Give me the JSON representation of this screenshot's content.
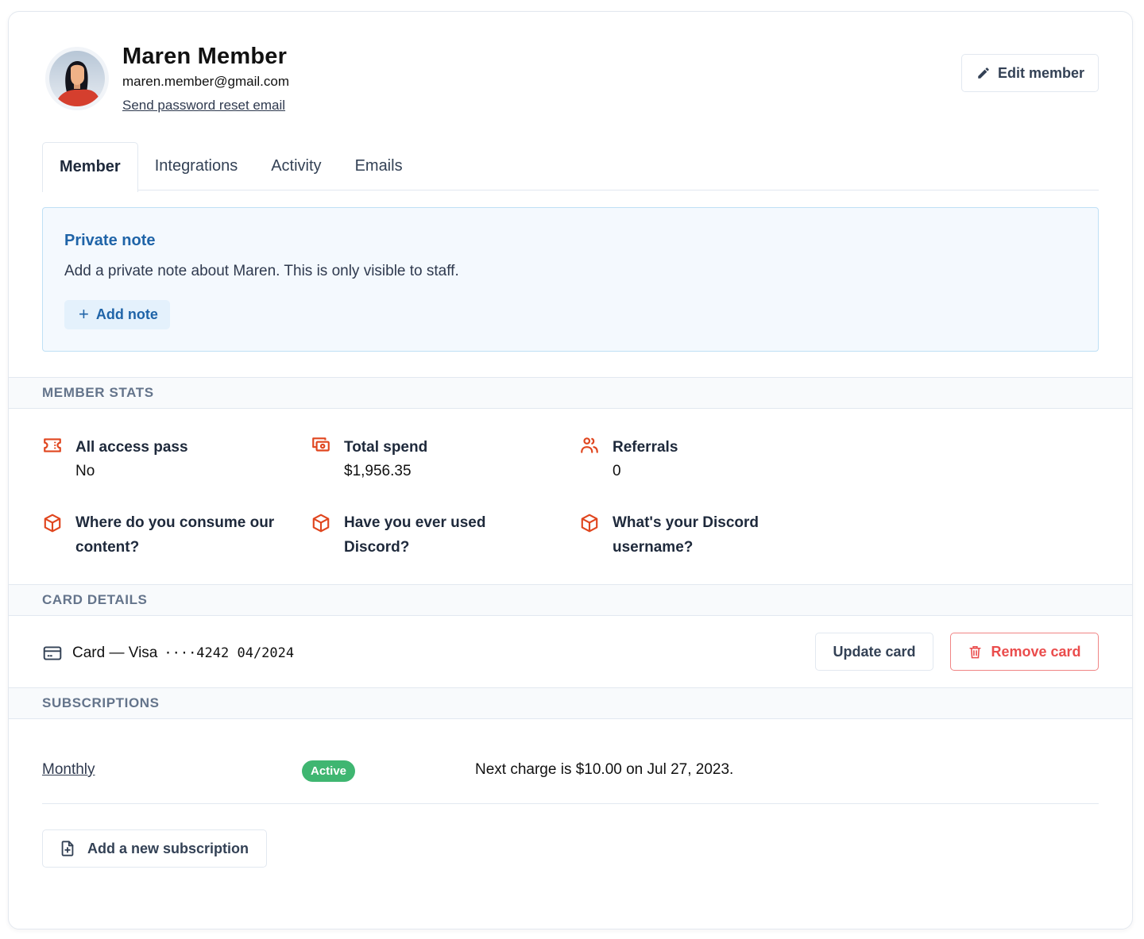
{
  "member": {
    "name": "Maren Member",
    "email": "maren.member@gmail.com",
    "reset_link": "Send password reset email",
    "edit_button": "Edit member"
  },
  "tabs": [
    {
      "label": "Member",
      "active": true
    },
    {
      "label": "Integrations",
      "active": false
    },
    {
      "label": "Activity",
      "active": false
    },
    {
      "label": "Emails",
      "active": false
    }
  ],
  "private_note": {
    "title": "Private note",
    "description": "Add a private note about Maren. This is only visible to staff.",
    "add_button": "Add note",
    "plus": "+"
  },
  "member_stats": {
    "heading": "MEMBER STATS",
    "items": [
      {
        "icon": "ticket-icon",
        "label": "All access pass",
        "value": "No"
      },
      {
        "icon": "money-icon",
        "label": "Total spend",
        "value": "$1,956.35"
      },
      {
        "icon": "users-icon",
        "label": "Referrals",
        "value": "0"
      },
      {
        "icon": "cube-icon",
        "label": "Where do you consume our content?",
        "value": ""
      },
      {
        "icon": "cube-icon",
        "label": "Have you ever used Discord?",
        "value": ""
      },
      {
        "icon": "cube-icon",
        "label": "What's your Discord username?",
        "value": ""
      }
    ]
  },
  "card_details": {
    "heading": "CARD DETAILS",
    "card_label": "Card — Visa",
    "card_number": "····4242 04/2024",
    "update_button": "Update card",
    "remove_button": "Remove card"
  },
  "subscriptions": {
    "heading": "SUBSCRIPTIONS",
    "items": [
      {
        "name": "Monthly",
        "status": "Active",
        "next_charge": "Next charge is $10.00 on  Jul 27, 2023."
      }
    ],
    "add_button": "Add a new subscription"
  },
  "colors": {
    "accent_orange": "#e0461f",
    "note_blue": "#1f64a8",
    "active_green": "#3fb671",
    "danger_red": "#ea4c4c"
  }
}
